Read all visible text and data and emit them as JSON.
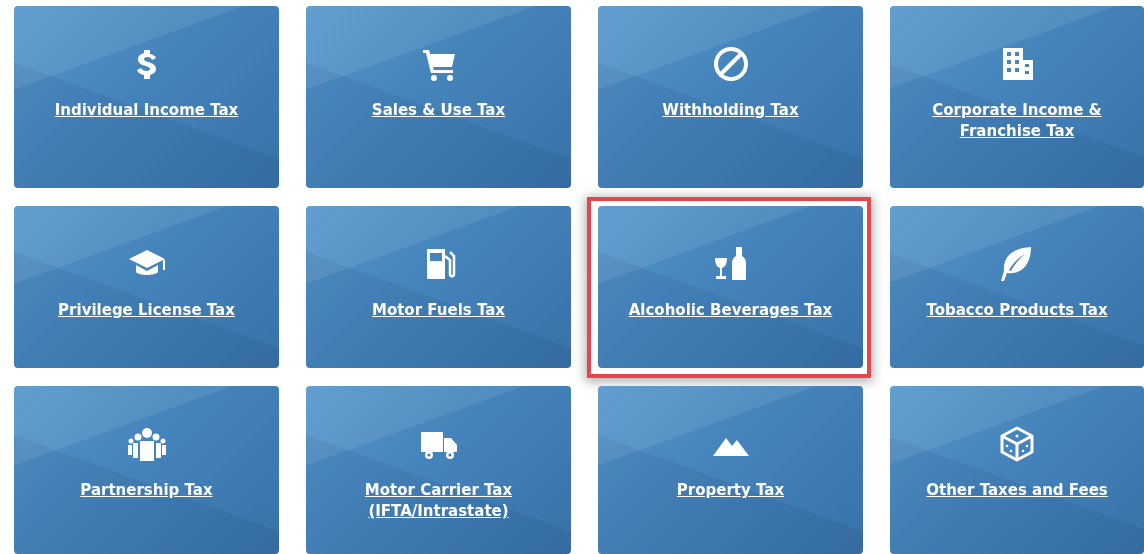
{
  "tiles": [
    {
      "label": "Individual Income Tax",
      "highlighted": false
    },
    {
      "label": "Sales & Use Tax",
      "highlighted": false
    },
    {
      "label": "Withholding Tax",
      "highlighted": false
    },
    {
      "label": "Corporate Income &\nFranchise Tax",
      "highlighted": false
    },
    {
      "label": "Privilege License Tax",
      "highlighted": false
    },
    {
      "label": "Motor Fuels Tax",
      "highlighted": false
    },
    {
      "label": "Alcoholic Beverages Tax",
      "highlighted": true
    },
    {
      "label": "Tobacco Products Tax",
      "highlighted": false
    },
    {
      "label": "Partnership Tax",
      "highlighted": false
    },
    {
      "label": "Motor Carrier Tax\n(IFTA/Intrastate)",
      "highlighted": false
    },
    {
      "label": "Property Tax",
      "highlighted": false
    },
    {
      "label": "Other Taxes and Fees",
      "highlighted": false
    }
  ]
}
